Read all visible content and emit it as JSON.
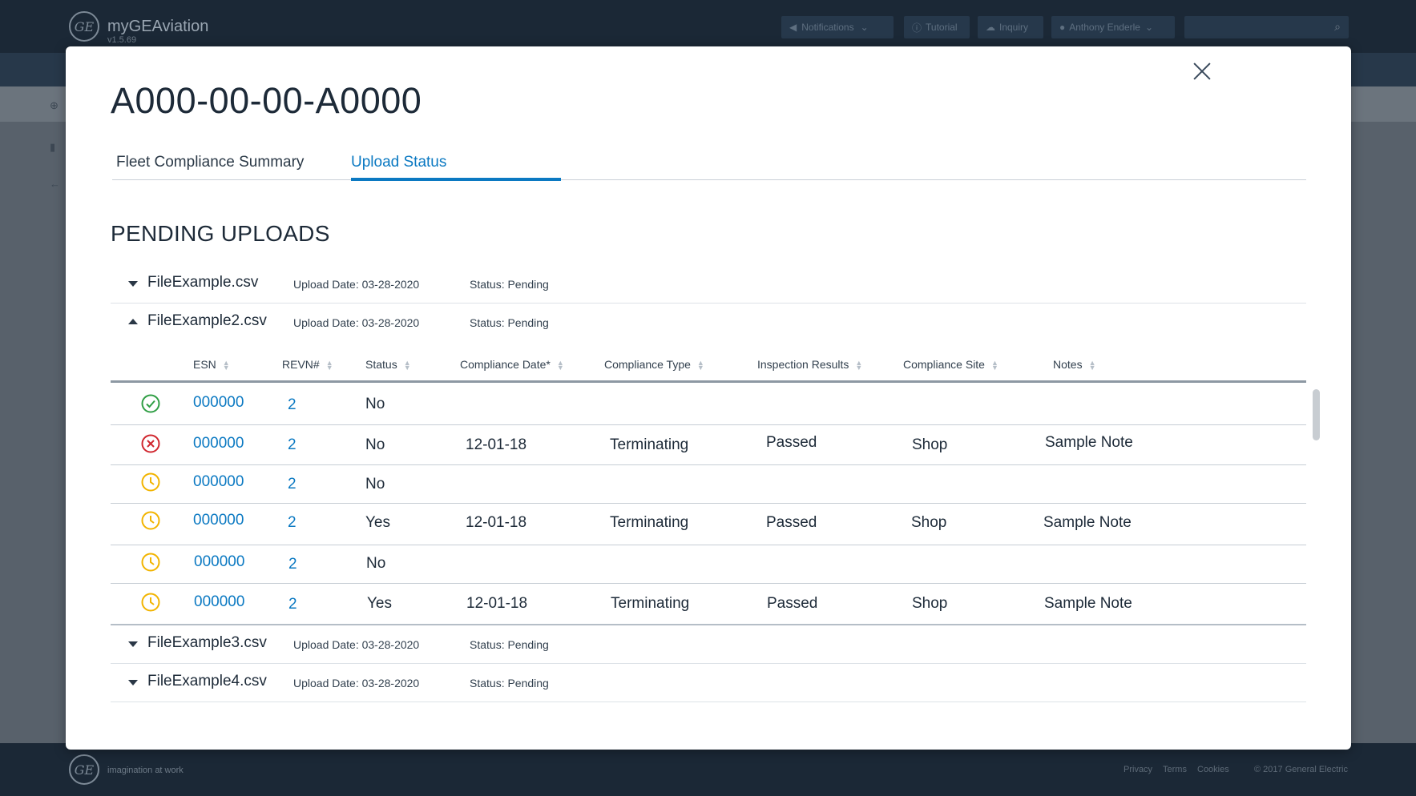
{
  "app": {
    "logo": "GE",
    "brand": "myGEAviation",
    "version": "v1.5.69",
    "nav": {
      "notifications": "Notifications",
      "tutorial": "Tutorial",
      "inquiry": "Inquiry",
      "user": "Anthony Enderle"
    },
    "footer": {
      "tagline": "imagination at work",
      "privacy": "Privacy",
      "terms": "Terms",
      "cookies": "Cookies",
      "copyright": "© 2017 General Electric"
    }
  },
  "modal": {
    "title": "A000-00-00-A0000",
    "tabs": [
      {
        "label": "Fleet Compliance Summary",
        "active": false
      },
      {
        "label": "Upload Status",
        "active": true
      }
    ],
    "section_title": "PENDING UPLOADS",
    "files": [
      {
        "name": "FileExample.csv",
        "upload_date": "Upload Date: 03-28-2020",
        "status": "Status: Pending",
        "expanded": false
      },
      {
        "name": "FileExample2.csv",
        "upload_date": "Upload Date: 03-28-2020",
        "status": "Status: Pending",
        "expanded": true
      },
      {
        "name": "FileExample3.csv",
        "upload_date": "Upload Date: 03-28-2020",
        "status": "Status: Pending",
        "expanded": false
      },
      {
        "name": "FileExample4.csv",
        "upload_date": "Upload Date: 03-28-2020",
        "status": "Status: Pending",
        "expanded": false
      }
    ],
    "table": {
      "columns": [
        "ESN",
        "REVN#",
        "Status",
        "Compliance Date*",
        "Compliance Type",
        "Inspection Results",
        "Compliance Site",
        "Notes"
      ],
      "rows": [
        {
          "icon": "check-circle-icon",
          "esn": "000000",
          "revn": "2",
          "status": "No",
          "date": "",
          "type": "",
          "results": "",
          "site": "",
          "notes": ""
        },
        {
          "icon": "error-circle-icon",
          "esn": "000000",
          "revn": "2",
          "status": "No",
          "date": "12-01-18",
          "type": "Terminating",
          "results": "Passed",
          "site": "Shop",
          "notes": "Sample Note"
        },
        {
          "icon": "clock-icon",
          "esn": "000000",
          "revn": "2",
          "status": "No",
          "date": "",
          "type": "",
          "results": "",
          "site": "",
          "notes": ""
        },
        {
          "icon": "clock-icon",
          "esn": "000000",
          "revn": "2",
          "status": "Yes",
          "date": "12-01-18",
          "type": "Terminating",
          "results": "Passed",
          "site": "Shop",
          "notes": "Sample Note"
        },
        {
          "icon": "clock-icon",
          "esn": "000000",
          "revn": "2",
          "status": "No",
          "date": "",
          "type": "",
          "results": "",
          "site": "",
          "notes": ""
        },
        {
          "icon": "clock-icon",
          "esn": "000000",
          "revn": "2",
          "status": "Yes",
          "date": "12-01-18",
          "type": "Terminating",
          "results": "Passed",
          "site": "Shop",
          "notes": "Sample Note"
        }
      ]
    }
  },
  "colors": {
    "accent": "#0b79c2",
    "success": "#2f9e44",
    "error": "#d0262e",
    "pending": "#f2b400"
  }
}
